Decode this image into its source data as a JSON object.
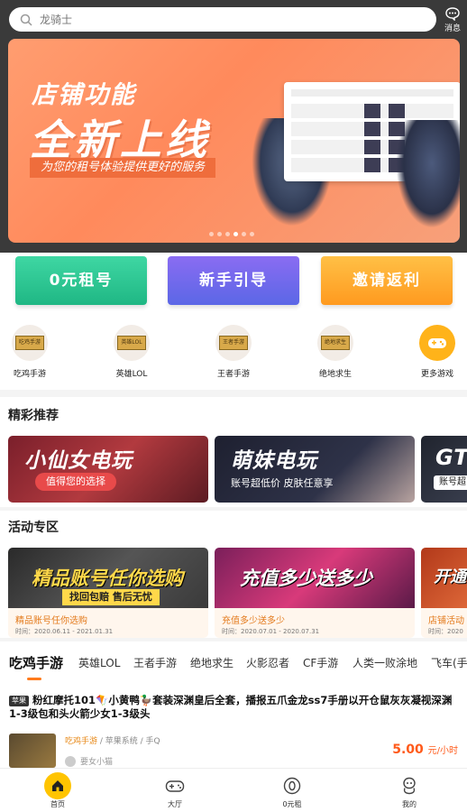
{
  "search": {
    "placeholder": "龙骑士"
  },
  "header": {
    "message_label": "消息"
  },
  "banner": {
    "title_line1": "店铺功能",
    "title_line2": "全新上线",
    "tagline": "为您的租号体验提供更好的服务",
    "dot_count": 6,
    "active_dot": 3
  },
  "quick_buttons": [
    {
      "label": "0元租号",
      "color": "#2cc48f"
    },
    {
      "label": "新手引导",
      "color": "#6b68ea"
    },
    {
      "label": "邀请返利",
      "color": "#ffad2e"
    }
  ],
  "games": [
    {
      "label": "吃鸡手游",
      "chip": "吃鸡手游"
    },
    {
      "label": "英雄LOL",
      "chip": "英雄LOL"
    },
    {
      "label": "王者手游",
      "chip": "王者手游"
    },
    {
      "label": "绝地求生",
      "chip": "绝地求生"
    },
    {
      "label": "更多游戏",
      "icon": "gamepad-icon"
    }
  ],
  "recommend": {
    "title": "精彩推荐",
    "cards": [
      {
        "headline": "小仙女电玩",
        "sub": "值得您的选择"
      },
      {
        "headline": "萌妹电玩",
        "sub": "账号超低价 皮肤任意享"
      },
      {
        "headline": "GT",
        "sub": "账号超"
      }
    ]
  },
  "activity": {
    "title": "活动专区",
    "cards": [
      {
        "headline": "精品账号任你选购",
        "banner_sub": "找回包赔 售后无忧",
        "caption": "精品账号任你选购",
        "time": "时间：2020.06.11 - 2021.01.31"
      },
      {
        "headline": "充值多少送多少",
        "caption": "充值多少送多少",
        "time": "时间：2020.07.01 - 2020.07.31"
      },
      {
        "headline": "开通",
        "caption": "店铺活动",
        "time": "时间：2020"
      }
    ]
  },
  "tabs": [
    {
      "label": "吃鸡手游",
      "active": true
    },
    {
      "label": "英雄LOL"
    },
    {
      "label": "王者手游"
    },
    {
      "label": "绝地求生"
    },
    {
      "label": "火影忍者"
    },
    {
      "label": "CF手游"
    },
    {
      "label": "人类一败涂地"
    },
    {
      "label": "飞车(手游)"
    }
  ],
  "listing": {
    "tag": "苹果",
    "title": "粉红摩托101🪁小黄鸭🦆套装深渊皇后全套，播报五爪金龙ss7手册以开仓鼠灰灰凝视深渊1-3级包和头火箭少女1-3级头",
    "game": "吃鸡手游",
    "system": "苹果系统 / 手Q",
    "seller": "要女小猫",
    "price": "5.00",
    "unit": "元/小时"
  },
  "nav": [
    {
      "label": "首页",
      "icon": "home-icon",
      "active": true
    },
    {
      "label": "大厅",
      "icon": "gamepad-icon"
    },
    {
      "label": "0元租",
      "icon": "zero-coin-icon"
    },
    {
      "label": "我的",
      "icon": "user-icon"
    }
  ]
}
